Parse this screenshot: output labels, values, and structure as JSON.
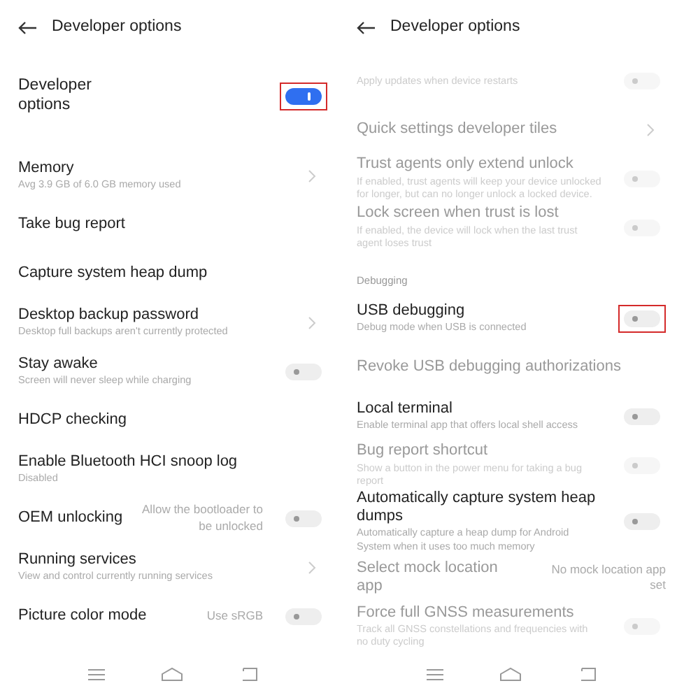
{
  "screens": [
    {
      "title": "Developer options",
      "items": [
        {
          "kind": "toggle",
          "title": "Developer options",
          "on": true,
          "highlighted": true,
          "big": true
        },
        {
          "kind": "chevron",
          "title": "Memory",
          "subtitle": "Avg 3.9 GB of 6.0 GB memory used",
          "disabled": false
        },
        {
          "kind": "plain",
          "title": "Take bug report",
          "disabled": false
        },
        {
          "kind": "plain",
          "title": "Capture system heap dump",
          "disabled": false
        },
        {
          "kind": "chevron",
          "title": "Desktop backup password",
          "subtitle": "Desktop full backups aren't currently protected",
          "disabled": false
        },
        {
          "kind": "toggle",
          "title": "Stay awake",
          "subtitle": "Screen will never sleep while charging",
          "on": false,
          "highlighted": false,
          "disabled": false
        },
        {
          "kind": "plain",
          "title": "HDCP checking",
          "disabled": false
        },
        {
          "kind": "plain",
          "title": "Enable Bluetooth HCI snoop log",
          "subtitle": "Disabled",
          "disabled": false
        },
        {
          "kind": "toggle",
          "title": "OEM unlocking",
          "value": "Allow the bootloader to be unlocked",
          "on": false,
          "highlighted": false,
          "disabled": false
        },
        {
          "kind": "chevron",
          "title": "Running services",
          "subtitle": "View and control currently running services",
          "disabled": false
        },
        {
          "kind": "toggle",
          "title": "Picture color mode",
          "value": "Use sRGB",
          "on": false,
          "highlighted": false,
          "disabled": false
        }
      ]
    },
    {
      "title": "Developer options",
      "items": [
        {
          "kind": "toggle",
          "subtitle": "Apply updates when device restarts",
          "on": false,
          "highlighted": false,
          "disabled": true
        },
        {
          "kind": "chevron",
          "title": "Quick settings developer tiles",
          "disabled": true
        },
        {
          "kind": "toggle",
          "title": "Trust agents only extend unlock",
          "subtitle": "If enabled, trust agents will keep your device unlocked for longer, but can no longer unlock a locked device.",
          "on": false,
          "highlighted": false,
          "disabled": true
        },
        {
          "kind": "toggle",
          "title": "Lock screen when trust is lost",
          "subtitle": "If enabled, the device will lock when the last trust agent loses trust",
          "on": false,
          "highlighted": false,
          "disabled": true
        },
        {
          "kind": "header",
          "title": "Debugging"
        },
        {
          "kind": "toggle",
          "title": "USB debugging",
          "subtitle": "Debug mode when USB is connected",
          "on": false,
          "highlighted": true,
          "disabled": false
        },
        {
          "kind": "plain",
          "title": "Revoke USB debugging authorizations",
          "disabled": true
        },
        {
          "kind": "toggle",
          "title": "Local terminal",
          "subtitle": "Enable terminal app that offers local shell access",
          "on": false,
          "highlighted": false,
          "disabled": false
        },
        {
          "kind": "toggle",
          "title": "Bug report shortcut",
          "subtitle": "Show a button in the power menu for taking a bug report",
          "on": false,
          "highlighted": false,
          "disabled": true
        },
        {
          "kind": "toggle",
          "title": "Automatically capture system heap dumps",
          "subtitle": "Automatically capture a heap dump for Android System when it uses too much memory",
          "on": false,
          "highlighted": false,
          "disabled": false
        },
        {
          "kind": "plain",
          "title": "Select mock location app",
          "value": "No mock location app set",
          "disabled": true
        },
        {
          "kind": "toggle",
          "title": "Force full GNSS measurements",
          "subtitle": "Track all GNSS constellations and frequencies with no duty cycling",
          "on": false,
          "highlighted": false,
          "disabled": true
        }
      ]
    }
  ]
}
